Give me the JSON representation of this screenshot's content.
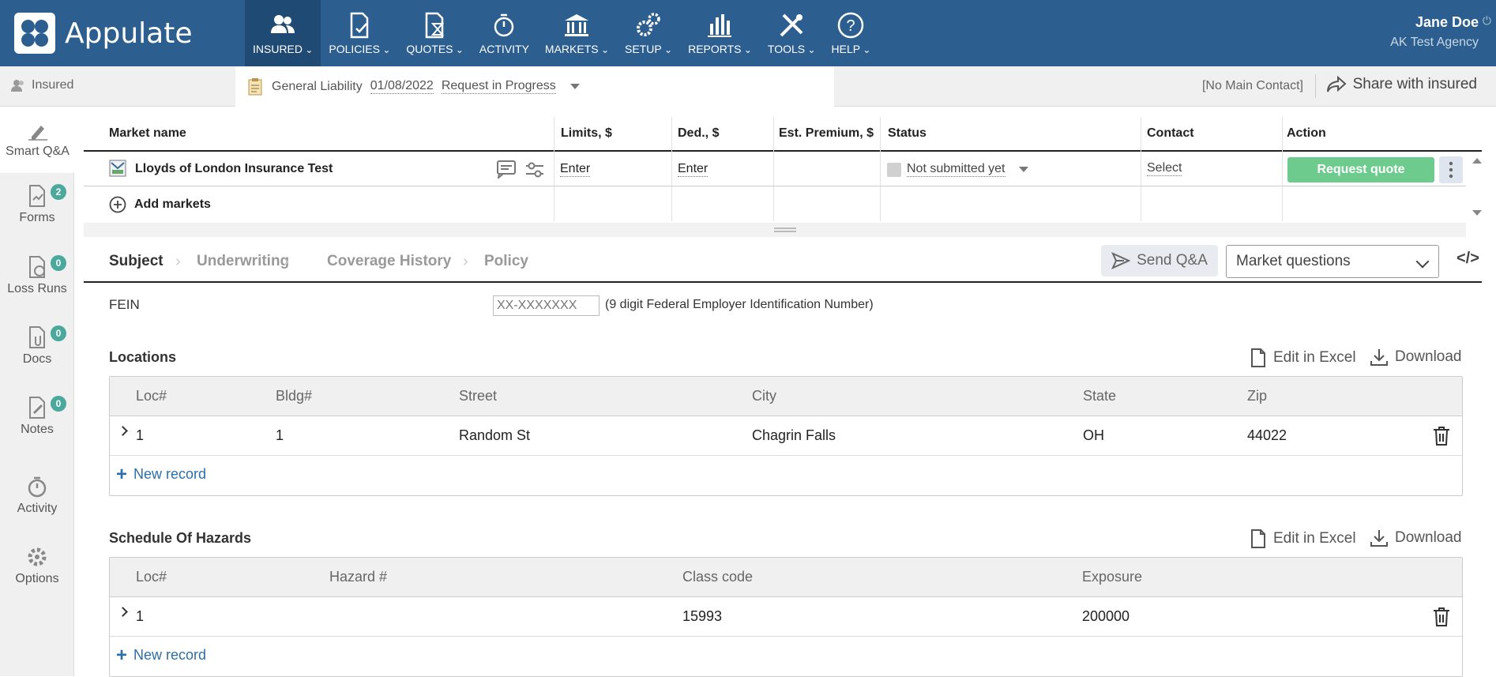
{
  "app": {
    "name": "Appulate"
  },
  "nav": [
    {
      "label": "INSURED",
      "icon": "users-icon",
      "active": true
    },
    {
      "label": "POLICIES",
      "icon": "policy-icon"
    },
    {
      "label": "QUOTES",
      "icon": "quote-icon"
    },
    {
      "label": "ACTIVITY",
      "icon": "activity-icon"
    },
    {
      "label": "MARKETS",
      "icon": "bank-icon"
    },
    {
      "label": "SETUP",
      "icon": "gears-icon"
    },
    {
      "label": "REPORTS",
      "icon": "bar-chart-icon"
    },
    {
      "label": "TOOLS",
      "icon": "tools-icon"
    },
    {
      "label": "HELP",
      "icon": "help-icon"
    }
  ],
  "user": {
    "name": "Jane Doe",
    "agency": "AK Test Agency"
  },
  "subbar": {
    "insured": "Insured",
    "policy_type": "General Liability",
    "policy_date": "01/08/2022",
    "policy_status": "Request in Progress",
    "main_contact": "[No Main Contact]",
    "share": "Share with insured"
  },
  "sidebar": [
    {
      "label": "Smart Q&A",
      "icon": "pen-icon"
    },
    {
      "label": "Forms",
      "icon": "forms-icon",
      "badge": "2"
    },
    {
      "label": "Loss Runs",
      "icon": "loss-runs-icon",
      "badge": "0"
    },
    {
      "label": "Docs",
      "icon": "docs-icon",
      "badge": "0"
    },
    {
      "label": "Notes",
      "icon": "notes-icon",
      "badge": "0"
    },
    {
      "label": "Activity",
      "icon": "activity-icon"
    },
    {
      "label": "Options",
      "icon": "gear-icon"
    }
  ],
  "markets": {
    "headers": {
      "name": "Market name",
      "limits": "Limits, $",
      "ded": "Ded., $",
      "premium": "Est. Premium, $",
      "status": "Status",
      "contact": "Contact",
      "action": "Action"
    },
    "row": {
      "name": "Lloyds of London Insurance Test",
      "limits": "Enter",
      "ded": "Enter",
      "status": "Not submitted yet",
      "contact": "Select",
      "action": "Request quote"
    },
    "add": "Add markets"
  },
  "qa": {
    "tabs": [
      "Subject",
      "Underwriting",
      "Coverage History",
      "Policy"
    ],
    "send": "Send Q&A",
    "select": "Market questions",
    "code": "</>"
  },
  "fein": {
    "label": "FEIN",
    "placeholder": "XX-XXXXXXX",
    "hint": "(9 digit Federal Employer Identification Number)"
  },
  "locations": {
    "title": "Locations",
    "edit": "Edit in Excel",
    "download": "Download",
    "headers": [
      "Loc#",
      "Bldg#",
      "Street",
      "City",
      "State",
      "Zip"
    ],
    "rows": [
      {
        "loc": "1",
        "bldg": "1",
        "street": "Random St",
        "city": "Chagrin Falls",
        "state": "OH",
        "zip": "44022"
      }
    ],
    "new": "New record"
  },
  "hazards": {
    "title": "Schedule Of Hazards",
    "edit": "Edit in Excel",
    "download": "Download",
    "headers": [
      "Loc#",
      "Hazard #",
      "Class code",
      "Exposure"
    ],
    "rows": [
      {
        "loc": "1",
        "hazard": "",
        "class_code": "15993",
        "exposure": "200000"
      }
    ],
    "new": "New record"
  }
}
